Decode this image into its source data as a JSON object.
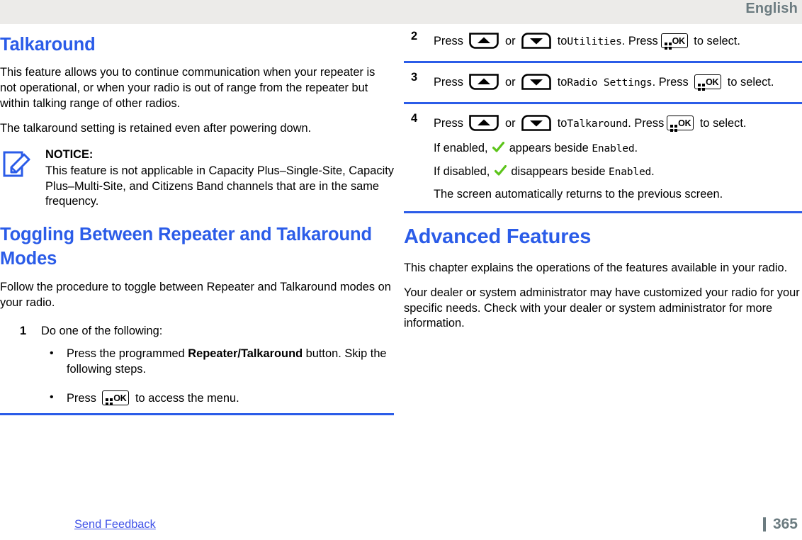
{
  "header": {
    "language": "English"
  },
  "left_column": {
    "section_title": "Talkaround",
    "paragraph_1": "This feature allows you to continue communication when your repeater is not operational, or when your radio is out of range from the repeater but within talking range of other radios.",
    "paragraph_2": "The talkaround setting is retained even after powering down.",
    "notice": {
      "icon": "notice-pencil-icon",
      "title": "NOTICE:",
      "text": "This feature is not applicable in Capacity Plus–Single-Site, Capacity Plus–Multi-Site, and Citizens Band channels that are in the same frequency."
    },
    "subsection_title": "Toggling Between Repeater and Talkaround Modes",
    "paragraph_3": "Follow the procedure to toggle between Repeater and Talkaround modes on your radio.",
    "step_1": {
      "number": "1",
      "text": "Do one of the following:",
      "bullets": [
        {
          "marker": "•",
          "prefix": "Press the programmed ",
          "bold": "Repeater/Talkaround",
          "suffix": " button. Skip the following steps."
        },
        {
          "marker": "•",
          "prefix": "Press ",
          "key": "ok-key-icon",
          "suffix": " to access the menu."
        }
      ]
    }
  },
  "right_column": {
    "steps": [
      {
        "number": "2",
        "press_label": "Press",
        "up_key": "up-arrow-key-icon",
        "or_label": "or",
        "down_key": "down-arrow-key-icon",
        "to_label": "to",
        "menu_item": "Utilities",
        "period": ".",
        "press_label_2": "Press",
        "ok_key": "ok-key-icon",
        "tail": "to select."
      },
      {
        "number": "3",
        "press_label": "Press",
        "up_key": "up-arrow-key-icon",
        "or_label": "or",
        "down_key": "down-arrow-key-icon",
        "to_label": "to",
        "menu_item": "Radio Settings",
        "period": ".",
        "press_label_2": "Press",
        "ok_key": "ok-key-icon",
        "tail": "to select."
      },
      {
        "number": "4",
        "press_label": "Press",
        "up_key": "up-arrow-key-icon",
        "or_label": "or",
        "down_key": "down-arrow-key-icon",
        "to_label": "to",
        "menu_item": "Talkaround",
        "period": ".",
        "press_label_2": "Press",
        "ok_key": "ok-key-icon",
        "tail": "to select.",
        "sub_lines": [
          {
            "prefix": "If enabled,",
            "icon": "green-check-icon",
            "middle": "appears beside",
            "mono": "Enabled",
            "suffix": "."
          },
          {
            "prefix": "If disabled,",
            "icon": "green-check-icon",
            "middle": "disappears beside",
            "mono": "Enabled",
            "suffix": "."
          }
        ],
        "note": "The screen automatically returns to the previous screen."
      }
    ],
    "chapter_title": "Advanced Features",
    "chapter_paragraph_1": "This chapter explains the operations of the features available in your radio.",
    "chapter_paragraph_2": "Your dealer or system administrator may have customized your radio for your specific needs. Check with your dealer or system administrator for more information."
  },
  "footer": {
    "feedback_link": "Send Feedback",
    "page_number": "365"
  },
  "colors": {
    "heading_blue": "#2b5ce8",
    "link_blue": "#3f52e8",
    "rule_blue": "#2b5ce8",
    "header_band": "#ecebe9",
    "header_text": "#6b7b80",
    "check_green": "#5cc41a"
  }
}
